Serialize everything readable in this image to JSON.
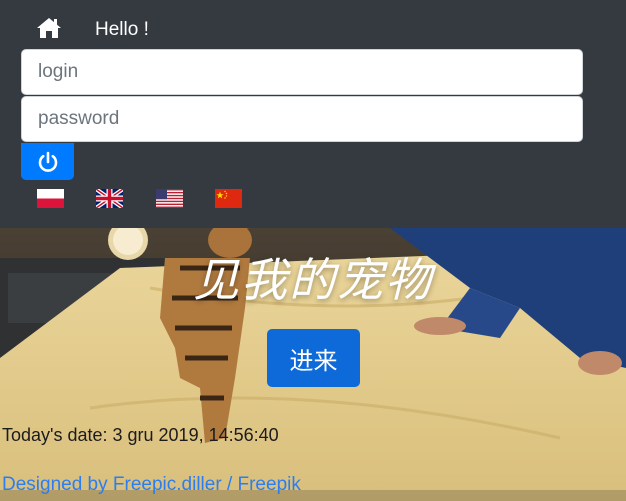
{
  "navbar": {
    "home_icon": "home-icon",
    "greeting": "Hello !",
    "login_placeholder": "login",
    "password_placeholder": "password",
    "power_icon": "power-icon",
    "flags": [
      "flag-poland",
      "flag-united-kingdom",
      "flag-united-states",
      "flag-china"
    ],
    "colors": {
      "navbar_bg": "#343a40",
      "primary": "#007bff"
    }
  },
  "hero": {
    "title": "见我的宠物",
    "enter_label": "进来",
    "date_text": "Today's date: 3 gru 2019, 14:56:40",
    "credit_text": "Designed by Freepic.diller / Freepik"
  }
}
